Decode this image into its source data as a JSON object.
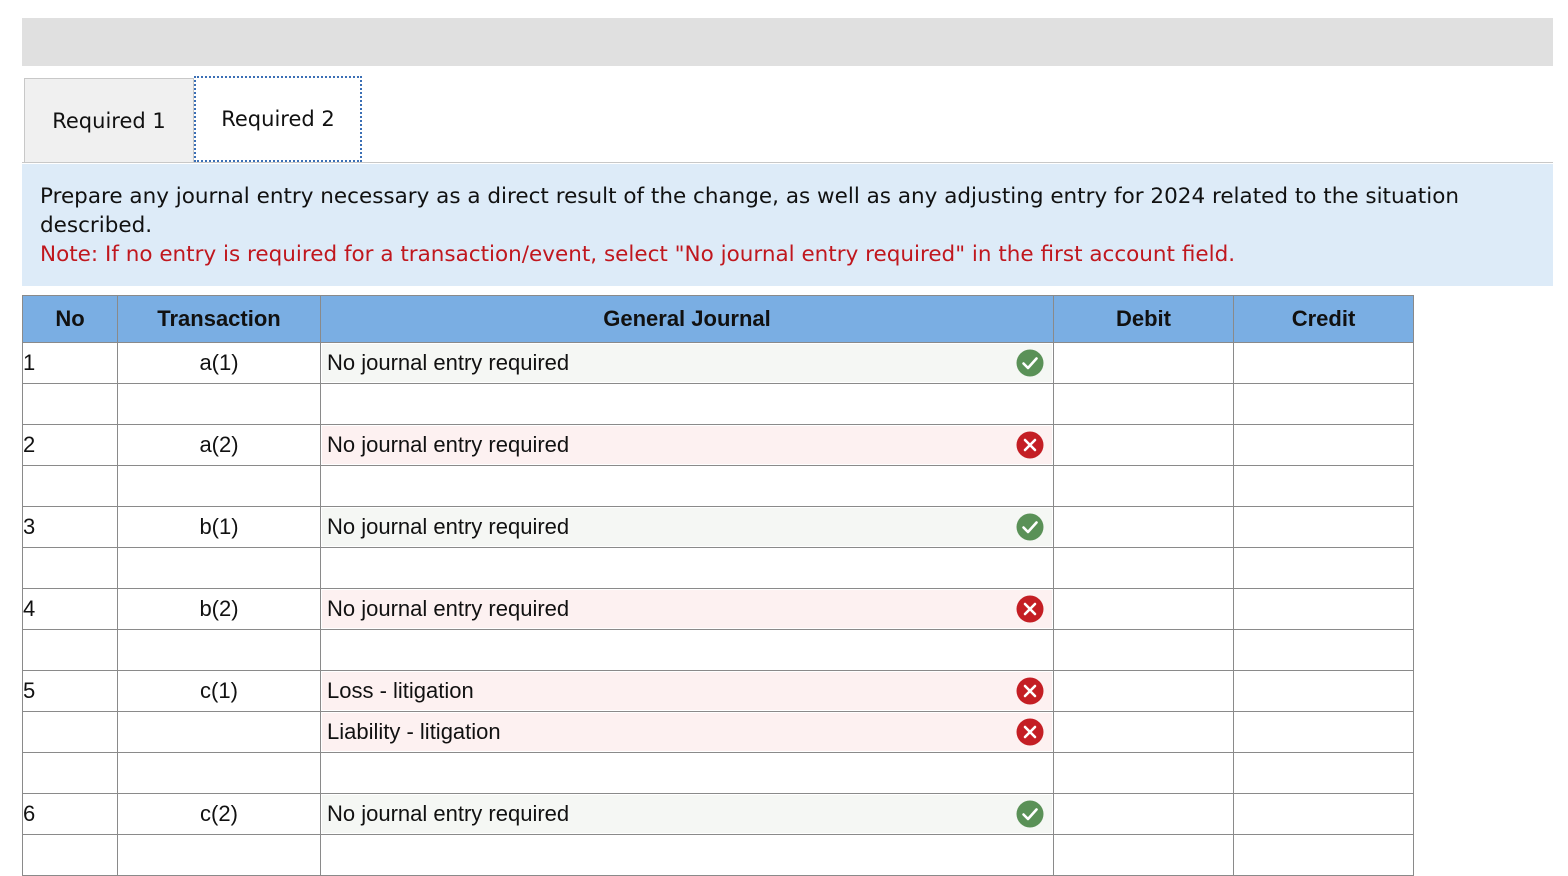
{
  "tabs": [
    {
      "label": "Required 1"
    },
    {
      "label": "Required 2"
    }
  ],
  "instructions": {
    "text": "Prepare any journal entry necessary as a direct result of the change, as well as any adjusting entry for 2024 related to the situation described.",
    "note": "Note: If no entry is required for a transaction/event, select \"No journal entry required\" in the first account field."
  },
  "table": {
    "headers": {
      "no": "No",
      "transaction": "Transaction",
      "general_journal": "General Journal",
      "debit": "Debit",
      "credit": "Credit"
    },
    "rows": [
      {
        "no": "1",
        "transaction": "a(1)",
        "account": "No journal entry required",
        "status": "correct"
      },
      {
        "no": "",
        "transaction": "",
        "account": "",
        "status": ""
      },
      {
        "no": "2",
        "transaction": "a(2)",
        "account": "No journal entry required",
        "status": "incorrect"
      },
      {
        "no": "",
        "transaction": "",
        "account": "",
        "status": ""
      },
      {
        "no": "3",
        "transaction": "b(1)",
        "account": "No journal entry required",
        "status": "correct"
      },
      {
        "no": "",
        "transaction": "",
        "account": "",
        "status": ""
      },
      {
        "no": "4",
        "transaction": "b(2)",
        "account": "No journal entry required",
        "status": "incorrect"
      },
      {
        "no": "",
        "transaction": "",
        "account": "",
        "status": ""
      },
      {
        "no": "5",
        "transaction": "c(1)",
        "account": "Loss - litigation",
        "status": "incorrect"
      },
      {
        "no": "",
        "transaction": "",
        "account": "Liability - litigation",
        "status": "incorrect"
      },
      {
        "no": "",
        "transaction": "",
        "account": "",
        "status": ""
      },
      {
        "no": "6",
        "transaction": "c(2)",
        "account": "No journal entry required",
        "status": "correct"
      },
      {
        "no": "",
        "transaction": "",
        "account": "",
        "status": ""
      }
    ]
  },
  "icons": {
    "correct": "check-circle-icon",
    "incorrect": "x-circle-icon"
  },
  "colors": {
    "header_bg": "#7aaee3",
    "note_red": "#c0171e",
    "correct_green": "#5a9157",
    "incorrect_red": "#c41e24",
    "instructions_bg": "#ddebf8"
  }
}
